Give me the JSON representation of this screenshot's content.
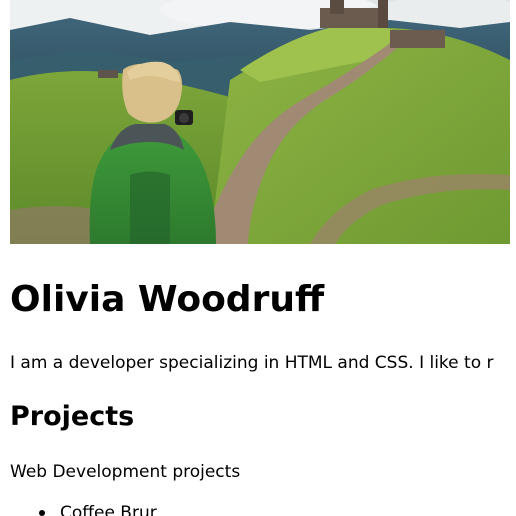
{
  "profile": {
    "hero_image": "hiker-photographing-hill-landscape",
    "name": "Olivia Woodruff",
    "intro": "I am a developer specializing in HTML and CSS. I like to r"
  },
  "projects": {
    "heading": "Projects",
    "subtitle": "Web Development projects",
    "items": [
      {
        "label": "Coffee Brur"
      }
    ]
  }
}
